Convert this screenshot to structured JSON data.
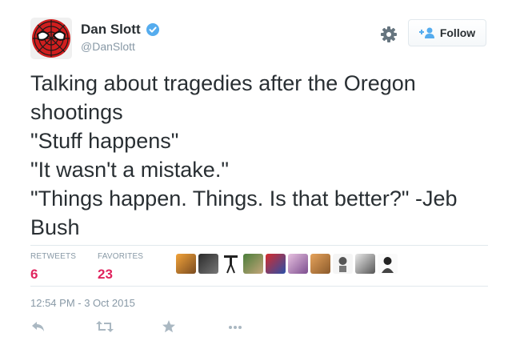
{
  "user": {
    "display_name": "Dan Slott",
    "handle": "@DanSlott",
    "verified": true,
    "avatar_icon": "spider-man-avatar"
  },
  "header": {
    "follow_label": "Follow",
    "settings_icon": "gear-icon",
    "follow_icon": "add-user-icon"
  },
  "tweet": {
    "lines": [
      "Talking about tragedies after the Oregon",
      "shootings",
      "\"Stuff happens\"",
      "\"It wasn't a mistake.\"",
      "\"Things happen. Things. Is that better?\" -Jeb",
      "Bush"
    ]
  },
  "stats": {
    "retweets_label": "RETWEETS",
    "retweets": "6",
    "favorites_label": "FAVORITES",
    "favorites": "23"
  },
  "favoriters_count_shown": 10,
  "timestamp": "12:54 PM - 3 Oct 2015",
  "actions": [
    "reply-icon",
    "retweet-icon",
    "favorite-icon",
    "more-icon"
  ],
  "colors": {
    "accent": "#55acee",
    "count": "#e0245e",
    "muted": "#8899a6",
    "divider": "#e1e8ed"
  }
}
